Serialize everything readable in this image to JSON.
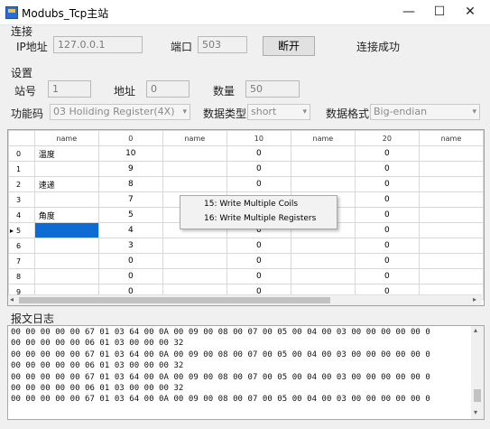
{
  "window": {
    "title": "Modubs_Tcp主站",
    "minimize": "—",
    "maximize": "☐",
    "close": "✕"
  },
  "connection": {
    "group_label": "连接",
    "ip_label": "IP地址",
    "ip_value": "127.0.0.1",
    "port_label": "端口",
    "port_value": "503",
    "disconnect_button": "断开",
    "status": "连接成功"
  },
  "settings": {
    "group_label": "设置",
    "station_label": "站号",
    "station_value": "1",
    "address_label": "地址",
    "address_value": "0",
    "quantity_label": "数量",
    "quantity_value": "50",
    "function_label": "功能码",
    "function_value": "03 Holiding Register(4X)",
    "datatype_label": "数据类型",
    "datatype_value": "short",
    "format_label": "数据格式",
    "format_value": "Big-endian"
  },
  "grid": {
    "headers": [
      "name",
      "0",
      "name",
      "10",
      "name",
      "20",
      "name"
    ],
    "rows": [
      {
        "index": "0",
        "name0": "温度",
        "v0": "10",
        "name10": "",
        "v10": "0",
        "name20": "",
        "v20": "0",
        "name30": ""
      },
      {
        "index": "1",
        "name0": "",
        "v0": "9",
        "name10": "",
        "v10": "0",
        "name20": "",
        "v20": "0",
        "name30": ""
      },
      {
        "index": "2",
        "name0": "速递",
        "v0": "8",
        "name10": "",
        "v10": "0",
        "name20": "",
        "v20": "0",
        "name30": ""
      },
      {
        "index": "3",
        "name0": "",
        "v0": "7",
        "name10": "",
        "v10": "4",
        "name20": "",
        "v20": "0",
        "name30": ""
      },
      {
        "index": "4",
        "name0": "角度",
        "v0": "5",
        "name10": "",
        "v10": "",
        "name20": "",
        "v20": "0",
        "name30": ""
      },
      {
        "index": "5",
        "name0": "",
        "v0": "4",
        "name10": "",
        "v10": "0",
        "name20": "",
        "v20": "0",
        "name30": ""
      },
      {
        "index": "6",
        "name0": "",
        "v0": "3",
        "name10": "",
        "v10": "0",
        "name20": "",
        "v20": "0",
        "name30": ""
      },
      {
        "index": "7",
        "name0": "",
        "v0": "0",
        "name10": "",
        "v10": "0",
        "name20": "",
        "v20": "0",
        "name30": ""
      },
      {
        "index": "8",
        "name0": "",
        "v0": "0",
        "name10": "",
        "v10": "0",
        "name20": "",
        "v20": "0",
        "name30": ""
      },
      {
        "index": "9",
        "name0": "",
        "v0": "0",
        "name10": "",
        "v10": "0",
        "name20": "",
        "v20": "0",
        "name30": ""
      }
    ],
    "current_row_marker": "▸",
    "selection_color": "#0d6cd4"
  },
  "context_menu": {
    "items": [
      "15:  Write Multiple Coils",
      "16:  Write Multiple Registers"
    ]
  },
  "log": {
    "label": "报文日志",
    "lines": [
      "00 00 00 00 00 67 01 03 64 00 0A 00 09 00 08 00 07 00 05 00 04 00 03 00 00 00 00 00 0",
      "00 00 00 00 00 06 01 03 00 00 00 32",
      "00 00 00 00 00 67 01 03 64 00 0A 00 09 00 08 00 07 00 05 00 04 00 03 00 00 00 00 00 0",
      "00 00 00 00 00 06 01 03 00 00 00 32",
      "00 00 00 00 00 67 01 03 64 00 0A 00 09 00 08 00 07 00 05 00 04 00 03 00 00 00 00 00 0",
      "00 00 00 00 00 06 01 03 00 00 00 32",
      "00 00 00 00 00 67 01 03 64 00 0A 00 09 00 08 00 07 00 05 00 04 00 03 00 00 00 00 00 0"
    ]
  }
}
